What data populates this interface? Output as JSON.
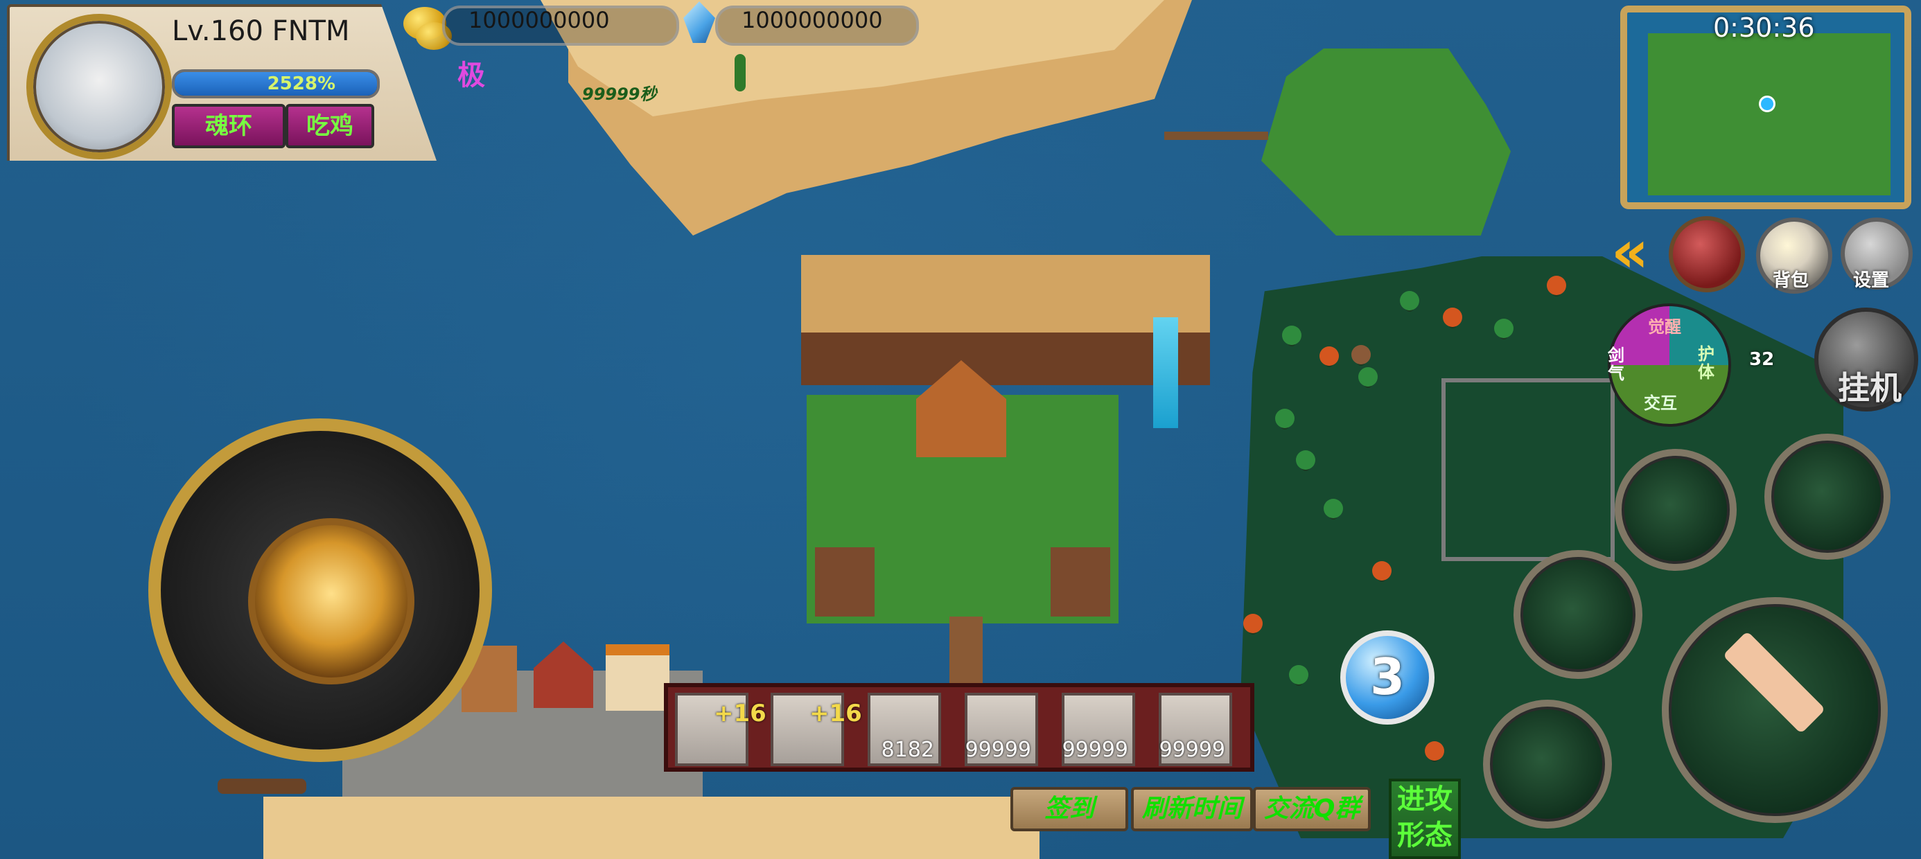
{
  "player": {
    "level_text": "Lv.160  FNTM",
    "xp_percent_text": "2528%",
    "xp_fill_fraction": 1.0,
    "btn_soul_ring": "魂环",
    "btn_eat_chicken": "吃鸡"
  },
  "resources": {
    "gold": "1000000000",
    "diamond": "1000000000",
    "tier_badge": "极",
    "timer_label": "99999秒"
  },
  "minimap": {
    "time": "0:30:36"
  },
  "right_menu": {
    "back_icon": "double-chevron-left-icon",
    "gourd_icon": "gourd-icon",
    "bag_label": "背包",
    "settings_label": "设置",
    "auto_label": "挂机"
  },
  "skill_wheel": {
    "top": "觉醒",
    "left": "剑气",
    "right": "护体",
    "bottom": "交互",
    "count": "32"
  },
  "pill": {
    "value": "3"
  },
  "items": [
    {
      "name": "ring",
      "plus": "+16",
      "count": ""
    },
    {
      "name": "crossbow",
      "plus": "+16",
      "count": ""
    },
    {
      "name": "orb",
      "plus": "",
      "count": "8182"
    },
    {
      "name": "scroll",
      "plus": "",
      "count": "99999"
    },
    {
      "name": "paper",
      "plus": "",
      "count": "99999"
    },
    {
      "name": "cloth",
      "plus": "",
      "count": "99999"
    }
  ],
  "bottom_buttons": {
    "sign_in": "签到",
    "refresh_time": "刷新时间",
    "q_group": "交流Q群",
    "attack_form_line1": "进攻",
    "attack_form_line2": "形态"
  }
}
